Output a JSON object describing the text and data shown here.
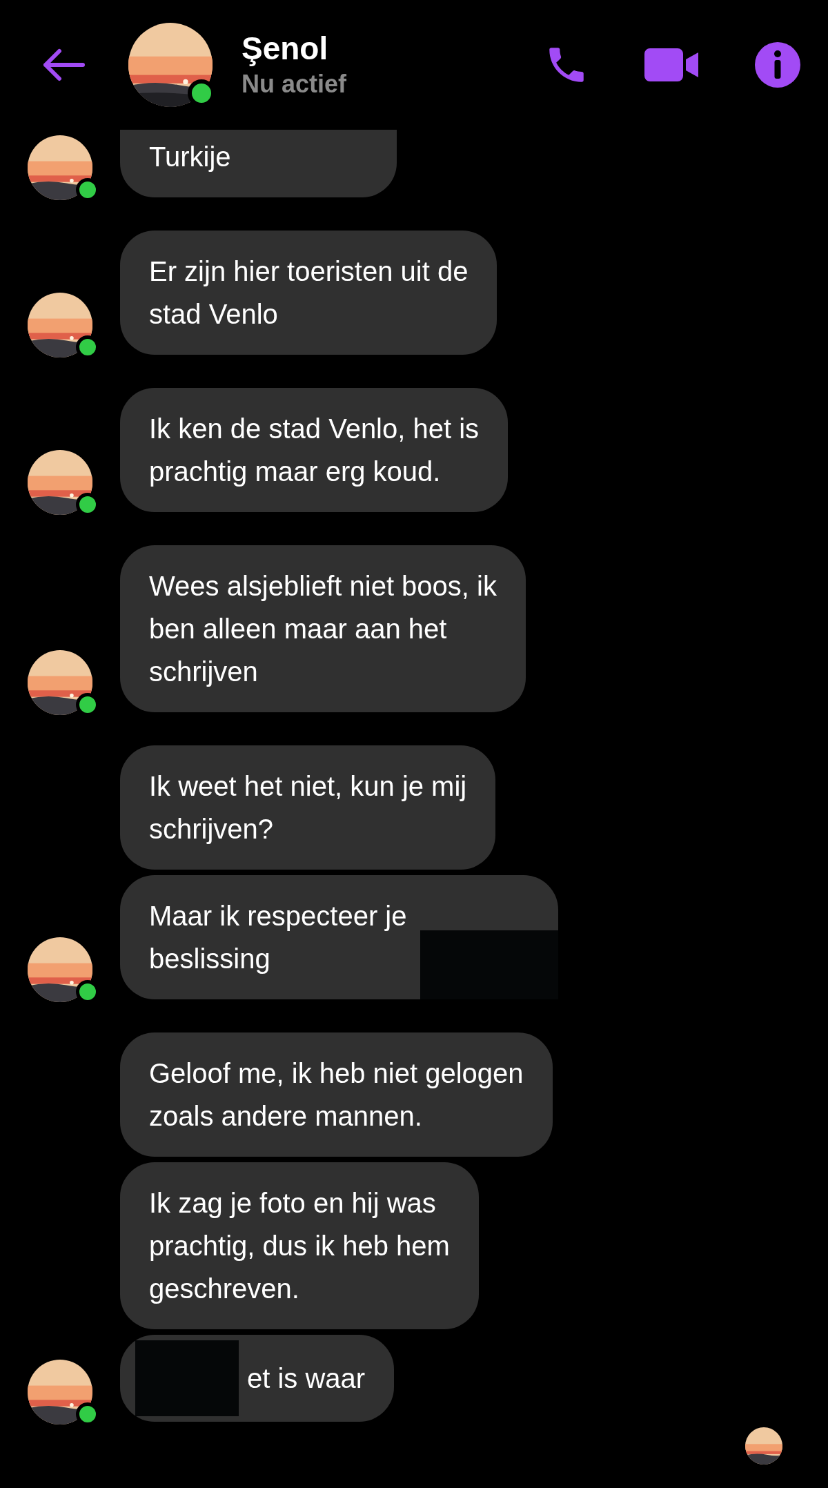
{
  "header": {
    "name": "Şenol",
    "status": "Nu actief",
    "online": true
  },
  "messages": [
    {
      "lines": [
        "Turkije"
      ],
      "avatar": true,
      "cut_top": true,
      "kind": "plain"
    },
    {
      "lines": [
        "Er zijn hier toeristen uit de",
        "stad Venlo"
      ],
      "avatar": true,
      "cut_top": false,
      "kind": "plain"
    },
    {
      "lines": [
        "Ik ken de stad Venlo, het is",
        "prachtig maar erg koud."
      ],
      "avatar": true,
      "cut_top": false,
      "kind": "plain"
    },
    {
      "lines": [
        "Wees alsjeblieft niet boos, ik",
        "ben alleen maar aan het",
        "schrijven"
      ],
      "avatar": true,
      "cut_top": false,
      "kind": "plain"
    },
    {
      "lines": [
        "Ik weet het niet, kun je mij",
        "schrijven?"
      ],
      "avatar": false,
      "cut_top": false,
      "kind": "plain"
    },
    {
      "lines": [
        "Maar ik respecteer je",
        "beslissing"
      ],
      "avatar": true,
      "cut_top": false,
      "kind": "redacted_end"
    },
    {
      "lines": [
        "Geloof me, ik heb niet gelogen",
        "zoals andere mannen."
      ],
      "avatar": false,
      "cut_top": false,
      "kind": "plain"
    },
    {
      "lines": [
        "Ik zag je foto en hij was",
        "prachtig, dus ik heb hem",
        "geschreven."
      ],
      "avatar": false,
      "cut_top": false,
      "kind": "plain"
    },
    {
      "lines": [
        "et is waar"
      ],
      "avatar": true,
      "cut_top": false,
      "kind": "redacted_start"
    }
  ],
  "seen": true
}
